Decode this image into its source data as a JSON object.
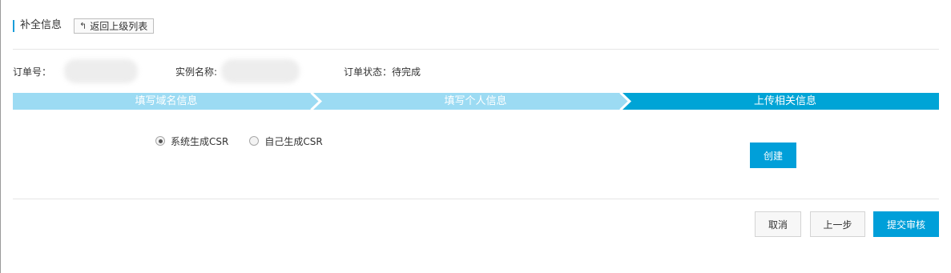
{
  "header": {
    "title": "补全信息",
    "back_label": "返回上级列表",
    "back_icon": "arrow-up-return-icon"
  },
  "info": {
    "order_no_label": "订单号：",
    "instance_name_label": "实例名称:",
    "order_status_label": "订单状态：",
    "order_status_value": "待完成"
  },
  "steps": [
    {
      "label": "填写域名信息",
      "state": "done"
    },
    {
      "label": "填写个人信息",
      "state": "done"
    },
    {
      "label": "上传相关信息",
      "state": "active"
    }
  ],
  "csr_options": [
    {
      "label": "系统生成CSR",
      "selected": true
    },
    {
      "label": "自己生成CSR",
      "selected": false
    }
  ],
  "create_label": "创建",
  "footer": {
    "cancel_label": "取消",
    "prev_label": "上一步",
    "submit_label": "提交审核"
  },
  "colors": {
    "step_done": "#9cdbf3",
    "step_active": "#00a4d6",
    "primary": "#009fd9",
    "accent_bar": "#1a9dd9"
  }
}
